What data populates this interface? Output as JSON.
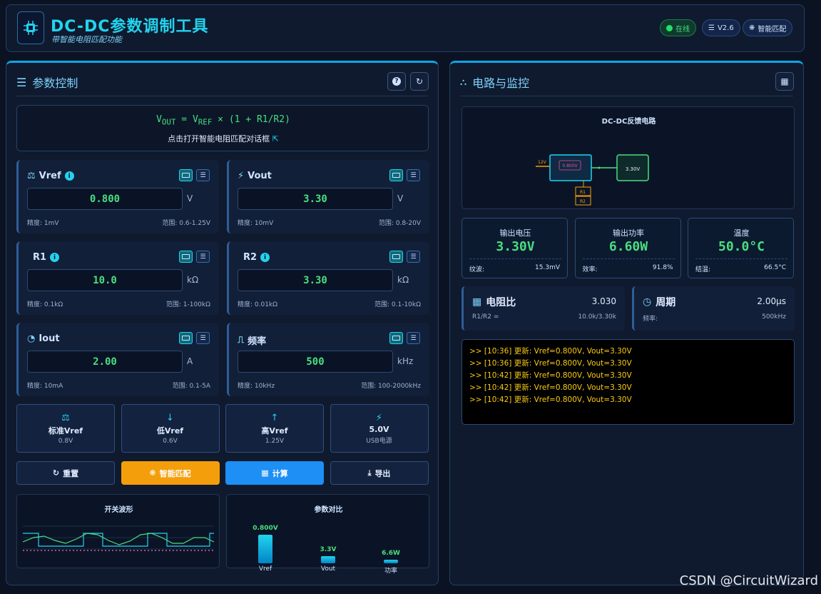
{
  "header": {
    "title": "DC-DC参数调制工具",
    "subtitle": "带智能电阻匹配功能",
    "badges": [
      "在线",
      "V2.6",
      "智能匹配"
    ]
  },
  "left": {
    "title": "参数控制",
    "formula_line2": "点击打开智能电阻匹配对话框",
    "formula": {
      "v": "V",
      "out": "OUT",
      "eq": " = ",
      "ref": "REF",
      "rest": " × (1 + R1/R2)"
    },
    "params": [
      {
        "label": "Vref",
        "value": "0.800",
        "unit": "V",
        "precision": "精度: 1mV",
        "range": "范围: 0.6-1.25V"
      },
      {
        "label": "Vout",
        "value": "3.30",
        "unit": "V",
        "precision": "精度: 10mV",
        "range": "范围: 0.8-20V"
      },
      {
        "label": "R1",
        "value": "10.0",
        "unit": "kΩ",
        "precision": "精度: 0.1kΩ",
        "range": "范围: 1-100kΩ"
      },
      {
        "label": "R2",
        "value": "3.30",
        "unit": "kΩ",
        "precision": "精度: 0.01kΩ",
        "range": "范围: 0.1-10kΩ"
      },
      {
        "label": "Iout",
        "value": "2.00",
        "unit": "A",
        "precision": "精度: 10mA",
        "range": "范围: 0.1-5A"
      },
      {
        "label": "频率",
        "value": "500",
        "unit": "kHz",
        "precision": "精度: 10kHz",
        "range": "范围: 100-2000kHz"
      }
    ],
    "presets": [
      {
        "label": "标准Vref",
        "sub": "0.8V"
      },
      {
        "label": "低Vref",
        "sub": "0.6V"
      },
      {
        "label": "高Vref",
        "sub": "1.25V"
      },
      {
        "label": "5.0V",
        "sub": "USB电源"
      }
    ],
    "actions": [
      "重置",
      "智能匹配",
      "计算",
      "导出"
    ],
    "wave_title": "开关波形",
    "compare_title": "参数对比"
  },
  "compare": {
    "bars": [
      {
        "name": "Vref",
        "label": "0.800V",
        "level": 0.6
      },
      {
        "name": "Vout",
        "label": "3.3V",
        "level": 0.15
      },
      {
        "name": "功率",
        "label": "6.6W",
        "level": 0.08
      }
    ]
  },
  "right": {
    "title": "电路与监控",
    "circuit": {
      "title": "DC-DC反馈电路",
      "vin": "12V",
      "chip": "0.800V",
      "out": "3.30V",
      "r1": "R1",
      "r2": "R2"
    },
    "stats": [
      {
        "title": "输出电压",
        "value": "3.30V",
        "k": "纹波:",
        "v": "15.3mV"
      },
      {
        "title": "输出功率",
        "value": "6.60W",
        "k": "效率:",
        "v": "91.8%"
      },
      {
        "title": "温度",
        "value": "50.0°C",
        "k": "结温:",
        "v": "66.5°C"
      }
    ],
    "ratio": {
      "title": "电阻比",
      "value": "3.030",
      "k": "R1/R2 =",
      "v": "10.0k/3.30k"
    },
    "period": {
      "title": "周期",
      "value": "2.00μs",
      "k": "频率:",
      "v": "500kHz"
    },
    "log": [
      ">> [10:36] 更新: Vref=0.800V, Vout=3.30V",
      ">> [10:36] 更新: Vref=0.800V, Vout=3.30V",
      ">> [10:42] 更新: Vref=0.800V, Vout=3.30V",
      ">> [10:42] 更新: Vref=0.800V, Vout=3.30V",
      ">> [10:42] 更新: Vref=0.800V, Vout=3.30V"
    ]
  },
  "watermark": "CSDN @CircuitWizard"
}
